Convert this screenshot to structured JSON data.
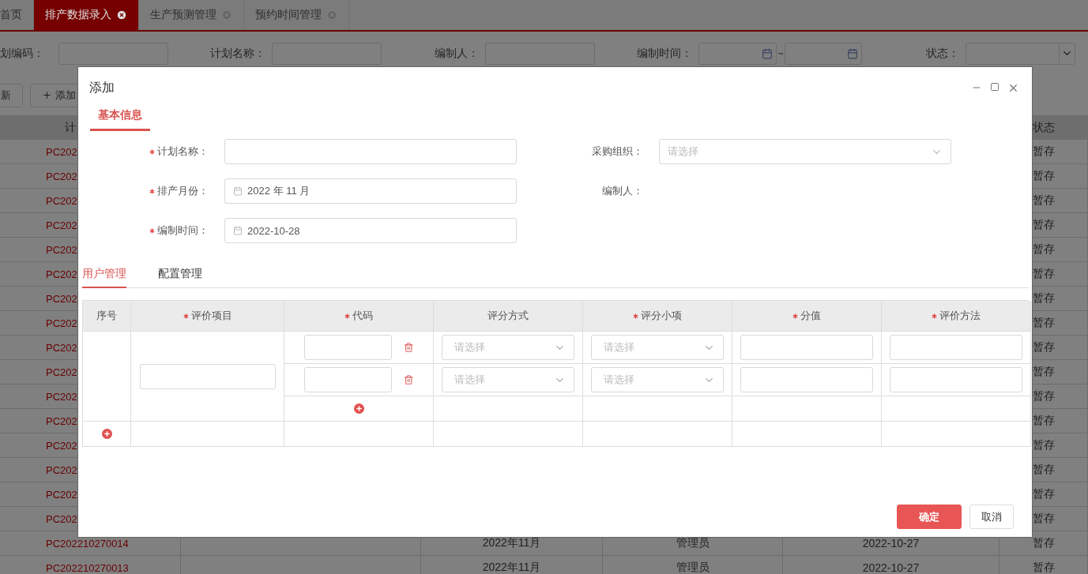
{
  "app_tabs": [
    {
      "label": "首页",
      "selected": false,
      "closable": false
    },
    {
      "label": "排产数据录入",
      "selected": true,
      "closable": true
    },
    {
      "label": "生产预测管理",
      "selected": false,
      "closable": true
    },
    {
      "label": "预约时间管理",
      "selected": false,
      "closable": true
    }
  ],
  "filters": [
    {
      "kind": "text",
      "label": "划编码："
    },
    {
      "kind": "text",
      "label": "计划名称："
    },
    {
      "kind": "text",
      "label": "编制人："
    },
    {
      "kind": "date_range",
      "label": "编制时间：",
      "separator": "~"
    },
    {
      "kind": "select",
      "label": "状态："
    }
  ],
  "toolbar": [
    {
      "label": "新",
      "kind": "plain"
    },
    {
      "label": "添加",
      "kind": "add"
    }
  ],
  "list_table": {
    "header": {
      "column_1": "计",
      "column_6": "状态"
    },
    "rows": [
      {
        "code": "PC202",
        "status": "暂存"
      },
      {
        "code": "PC202",
        "status": "暂存"
      },
      {
        "code": "PC202",
        "status": "暂存"
      },
      {
        "code": "PC202",
        "status": "暂存"
      },
      {
        "code": "PC202",
        "status": "暂存"
      },
      {
        "code": "PC202",
        "status": "暂存"
      },
      {
        "code": "PC202",
        "status": "暂存"
      },
      {
        "code": "PC202",
        "status": "暂存"
      },
      {
        "code": "PC202",
        "status": "暂存"
      },
      {
        "code": "PC202",
        "status": "暂存"
      },
      {
        "code": "PC202",
        "status": "暂存"
      },
      {
        "code": "PC202",
        "status": "暂存"
      },
      {
        "code": "PC202",
        "status": "暂存"
      },
      {
        "code": "PC202",
        "status": "暂存"
      },
      {
        "code": "PC202",
        "status": "暂存"
      },
      {
        "code": "PC202",
        "status": "暂存"
      },
      {
        "code": "PC202210270014",
        "month": "2022年11月",
        "editor": "管理员",
        "date": "2022-10-27",
        "status": "暂存"
      },
      {
        "code": "PC202210270013",
        "month": "2022年11月",
        "editor": "管理员",
        "date": "2022-10-27",
        "status": "暂存"
      }
    ]
  },
  "modal": {
    "title": "添加",
    "section_tabs": [
      {
        "label": "基本信息",
        "selected": true
      }
    ],
    "fields": [
      {
        "kind": "text",
        "label": "计划名称：",
        "required": true
      },
      {
        "kind": "select",
        "label": "采购组织：",
        "required": false,
        "placeholder": "请选择"
      },
      {
        "kind": "date",
        "label": "排产月份：",
        "required": true,
        "value": "2022 年 11 月"
      },
      {
        "kind": "readonly",
        "label": "编制人：",
        "required": false
      },
      {
        "kind": "date",
        "label": "编制时间：",
        "required": true,
        "value": "2022-10-28"
      }
    ],
    "detail_tabs": [
      {
        "label": "用户管理",
        "selected": true
      },
      {
        "label": "配置管理",
        "selected": false
      }
    ],
    "grid": {
      "columns": [
        {
          "label": "序号",
          "required": false
        },
        {
          "label": "评价项目",
          "required": true
        },
        {
          "label": "代码",
          "required": true
        },
        {
          "label": "评分方式",
          "required": false
        },
        {
          "label": "评分小项",
          "required": true
        },
        {
          "label": "分值",
          "required": true
        },
        {
          "label": "评价方法",
          "required": true
        }
      ],
      "items": [
        {
          "sub_rows": [
            {
              "method": {
                "placeholder": "请选择"
              },
              "subitem": {
                "placeholder": "请选择"
              }
            },
            {
              "method": {
                "placeholder": "请选择"
              },
              "subitem": {
                "placeholder": "请选择"
              }
            }
          ]
        }
      ]
    },
    "buttons": [
      {
        "label": "确定",
        "kind": "primary"
      },
      {
        "label": "取消",
        "kind": "default"
      }
    ]
  }
}
